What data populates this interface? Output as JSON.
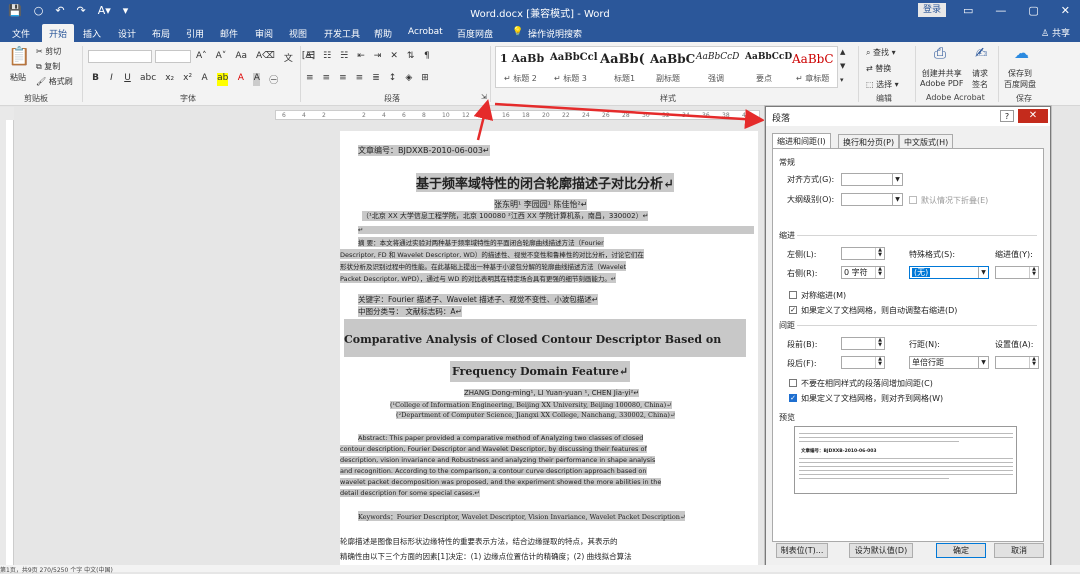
{
  "titlebar": {
    "quick_access": [
      "💾",
      "○",
      "↶",
      "↷",
      "A▾",
      "▾"
    ],
    "doc_title": "Word.docx [兼容模式] - Word",
    "login": "登录",
    "win_controls": [
      "▭",
      "—",
      "▢",
      "✕"
    ]
  },
  "tabs": [
    "文件",
    "开始",
    "插入",
    "设计",
    "布局",
    "引用",
    "邮件",
    "审阅",
    "视图",
    "开发工具",
    "帮助",
    "Acrobat",
    "百度网盘"
  ],
  "active_tab": "开始",
  "tell_me": "操作说明搜索",
  "share": "共享",
  "ribbon": {
    "groups": {
      "clipboard": "剪贴板",
      "font": "字体",
      "paragraph": "段落",
      "styles": "样式",
      "edit": "编辑",
      "adobe": "Adobe Acrobat",
      "save": "保存"
    },
    "paste": "粘贴",
    "cut": "剪切",
    "copy": "复制",
    "format_painter": "格式刷",
    "styles": [
      {
        "sample": "1 AaBb",
        "label": "↵ 标题 2"
      },
      {
        "sample": "AaBbCcl",
        "label": "↵ 标题 3"
      },
      {
        "sample": "AaBb(",
        "label": "标题1"
      },
      {
        "sample": "AaBbC",
        "label": "副标题"
      },
      {
        "sample": "AaBbCcD",
        "label": "强调"
      },
      {
        "sample": "AaBbCcD",
        "label": "要点"
      },
      {
        "sample": "AaBbC",
        "label": "↵ 章标题"
      }
    ],
    "find": "查找",
    "replace": "替换",
    "select": "选择",
    "create_pdf": "创建并共享\nAdobe PDF",
    "request_sign": "请求\n签名",
    "save_baidu": "保存到\n百度网盘"
  },
  "ruler_ticks": [
    "6",
    "4",
    "2",
    "",
    "2",
    "4",
    "6",
    "8",
    "10",
    "12",
    "14",
    "16",
    "18",
    "20",
    "22",
    "24",
    "26",
    "28",
    "30",
    "32",
    "34",
    "36",
    "38",
    "40"
  ],
  "document": {
    "article_no": "文章编号：BJDXXB-2010-06-003↵",
    "title_cn": "基于频率域特性的闭合轮廓描述子对比分析↵",
    "authors_cn": "张东明¹  李园园¹  陈佳怡²↵",
    "affil_cn": "（¹北京 XX 大学信息工程学院，北京  100080     ²江西 XX 学院计算机系，南昌，330002）↵",
    "abstract_cn": [
      "摘    要：本文将通过实验对两种基于频率域特性的平面闭合轮廓曲线描述方法（Fourier",
      "Descriptor, FD 和 Wavelet Descriptor, WD）的描述性、视觉不变性和鲁棒性的对比分析，讨论它们在",
      "形状分析及识别过程中的性能。在此基础上提出一种基于小波包分解的轮廓曲线描述方法（Wavelet",
      "Packet Descriptor, WPD），通过与 WD 的对比表明其在特定场合具有更强的细节刻画能力。↵"
    ],
    "keywords_cn": "关键字：Fourier 描述子、Wavelet 描述子、视觉不变性、小波包描述↵",
    "class_cn": "中图分类号：              文献标志码：A↵",
    "title_en_1": "Comparative Analysis of Closed Contour Descriptor Based on",
    "title_en_2": "Frequency Domain Feature↵",
    "authors_en": "ZHANG Dong-ming¹, LI Yuan-yuan ¹, CHEN Jia-yi²↵",
    "affil_en_1": "(¹College of Information Engineering, Beijing XX University, Beijing 100080, China)↵",
    "affil_en_2": "(²Department of Computer Science, Jiangxi XX College, Nanchang, 330002, China)↵",
    "abstract_en": [
      "Abstract: This paper provided a comparative method of Analyzing two classes of closed",
      "contour description, Fourier Descriptor and Wavelet Descriptor, by discussing their features of",
      "description, vision invariance and Robustness and analyzing their performance in shape analysis",
      "and recognition. According to the comparison, a contour curve description approach based on",
      "wavelet packet decomposition was proposed, and the experiment showed the more abilities in the",
      "detail description for some special cases.↵"
    ],
    "keywords_en": "Keywords：Fourier Descriptor, Wavelet Descriptor, Vision Invariance, Wavelet Packet Description↵",
    "body": [
      "轮廓描述是图像目标形状边缘特性的重要表示方法，结合边缘提取的特点，其表示的",
      "精确性由以下三个方面的因素[1]决定：(1) 边缘点位置估计的精确度；(2) 曲线拟合算法"
    ]
  },
  "statusbar": "第1页，共9页    270/5250 个字    中文(中国)",
  "dialog": {
    "title": "段落",
    "help": "?",
    "close": "✕",
    "tabs": [
      "缩进和间距(I)",
      "换行和分页(P)",
      "中文版式(H)"
    ],
    "general": "常规",
    "align_label": "对齐方式(G):",
    "outline_label": "大纲级别(O):",
    "collapse_default": "默认情况下折叠(E)",
    "indent": "缩进",
    "left_label": "左侧(L):",
    "right_label": "右侧(R):",
    "right_value": "0 字符",
    "special_label": "特殊格式(S):",
    "special_value": "(无)",
    "indent_value_label": "缩进值(Y):",
    "mirror_indent": "对称缩进(M)",
    "auto_adjust": "如果定义了文档网格，则自动调整右缩进(D)",
    "spacing": "间距",
    "before_label": "段前(B):",
    "after_label": "段后(F):",
    "line_spacing_label": "行距(N):",
    "line_spacing_value": "单倍行距",
    "at_label": "设置值(A):",
    "no_space_same": "不要在相同样式的段落间增加间距(C)",
    "snap_grid": "如果定义了文档网格，则对齐到网格(W)",
    "preview": "预览",
    "preview_text": "文章编号：BJDXXB-2010-06-003",
    "tabs_btn": "制表位(T)...",
    "default_btn": "设为默认值(D)",
    "ok": "确定",
    "cancel": "取消"
  }
}
